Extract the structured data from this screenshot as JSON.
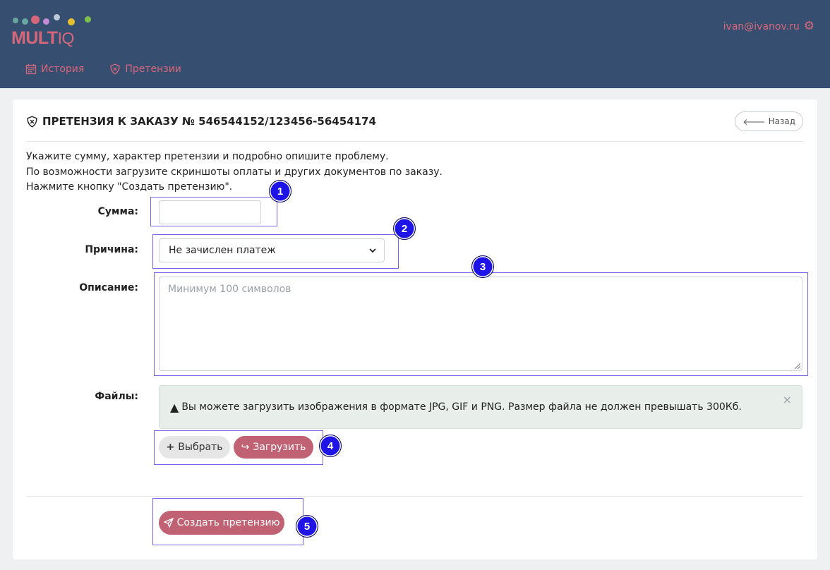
{
  "brand": {
    "logo_text": "MULT",
    "logo_suffix": "IQ",
    "colors": {
      "header_bg": "#364f70",
      "accent": "#d6677a",
      "button": "#c06273",
      "annotation": "#1f14e6"
    }
  },
  "header": {
    "user_email": "ivan@ivanov.ru",
    "settings_icon": "gear-icon"
  },
  "nav": {
    "items": [
      {
        "label": "История",
        "icon": "calendar-icon"
      },
      {
        "label": "Претензии",
        "icon": "shield-icon"
      }
    ]
  },
  "page": {
    "title": "ПРЕТЕНЗИЯ К ЗАКАЗУ № 546544152/123456-56454174",
    "back_label": "Назад",
    "intro": [
      "Укажите сумму, характер претензии и подробно опишите проблему.",
      "По возможности загрузите скриншоты оплаты и других документов по заказу.",
      "Нажмите кнопку \"Создать претензию\"."
    ]
  },
  "form": {
    "amount_label": "Сумма:",
    "amount_value": "",
    "reason_label": "Причина:",
    "reason_selected": "Не зачислен платеж",
    "description_label": "Описание:",
    "description_placeholder": "Минимум 100 символов",
    "files_label": "Файлы:",
    "files_alert": "Вы можете загрузить изображения в формате JPG, GIF и PNG. Размер файла не должен превышать 300Кб.",
    "alert_close": "×",
    "choose_label": "Выбрать",
    "upload_label": "Загрузить",
    "submit_label": "Создать претензию"
  },
  "annotations": [
    "1",
    "2",
    "3",
    "4",
    "5"
  ]
}
